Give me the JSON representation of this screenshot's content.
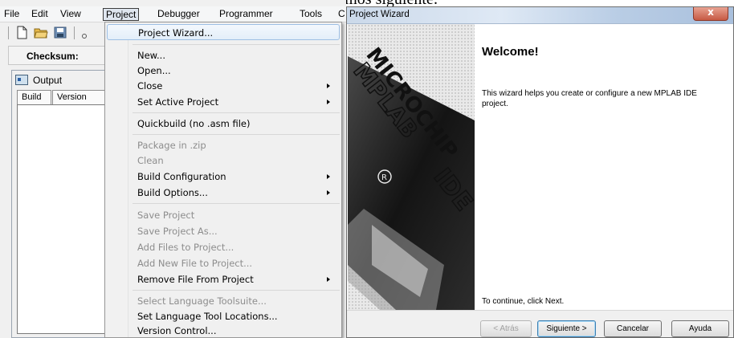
{
  "page_text": "Project Wizard, y a la pantalla que nos muestra el damos siguiente:",
  "menubar": {
    "items": [
      "File",
      "Edit",
      "View",
      "Project",
      "Debugger",
      "Programmer",
      "Tools",
      "C"
    ]
  },
  "checksum": {
    "label": "Checksum:"
  },
  "output": {
    "title": "Output",
    "tabs": [
      "Build",
      "Version"
    ]
  },
  "project_menu": {
    "items": [
      {
        "label": "Project Wizard...",
        "state": "highlighted"
      },
      {
        "label": "New..."
      },
      {
        "label": "Open..."
      },
      {
        "label": "Close",
        "submenu": true
      },
      {
        "label": "Set Active Project",
        "submenu": true
      },
      {
        "label": "Quickbuild (no .asm file)"
      },
      {
        "label": "Package in .zip",
        "state": "disabled"
      },
      {
        "label": "Clean",
        "state": "disabled"
      },
      {
        "label": "Build Configuration",
        "submenu": true
      },
      {
        "label": "Build Options...",
        "submenu": true
      },
      {
        "label": "Save Project",
        "state": "disabled"
      },
      {
        "label": "Save Project As...",
        "state": "disabled"
      },
      {
        "label": "Add Files to Project...",
        "state": "disabled"
      },
      {
        "label": "Add New File to Project...",
        "state": "disabled"
      },
      {
        "label": "Remove File From Project",
        "submenu": true
      },
      {
        "label": "Select Language Toolsuite...",
        "state": "disabled"
      },
      {
        "label": "Set Language Tool Locations..."
      },
      {
        "label": "Version Control..."
      }
    ]
  },
  "wizard": {
    "title": "Project Wizard",
    "close_label": "x",
    "logo_text": [
      "MICROCHIP",
      "MPLAB",
      "IDE"
    ],
    "heading": "Welcome!",
    "description": "This wizard helps you create or configure a new MPLAB IDE project.",
    "continue_hint": "To continue, click Next.",
    "buttons": {
      "back": "< Atrás",
      "next": "Siguiente >",
      "cancel": "Cancelar",
      "help": "Ayuda"
    }
  },
  "colors": {
    "menu_highlight": "#e3eef9",
    "disabled_text": "#8d8d8d",
    "close_button": "#c75a44"
  }
}
